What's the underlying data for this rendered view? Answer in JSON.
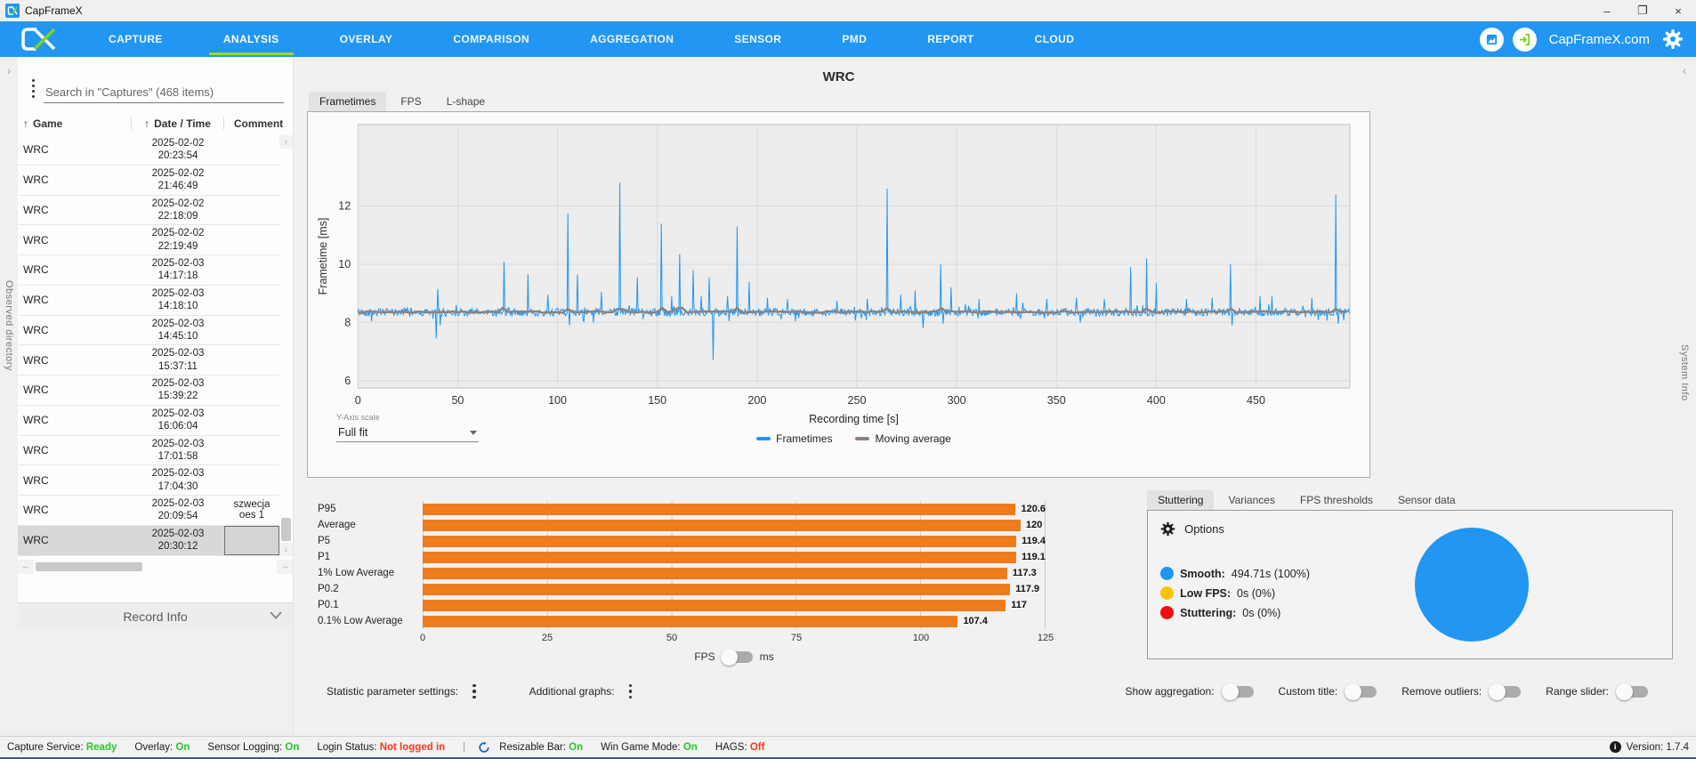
{
  "window": {
    "title": "CapFrameX",
    "controls": {
      "minimize": "–",
      "maximize": "❐",
      "close": "×"
    }
  },
  "nav": {
    "items": [
      {
        "label": "CAPTURE",
        "name": "nav-tab-capture",
        "active": false
      },
      {
        "label": "ANALYSIS",
        "name": "nav-tab-analysis",
        "active": true
      },
      {
        "label": "OVERLAY",
        "name": "nav-tab-overlay",
        "active": false
      },
      {
        "label": "COMPARISON",
        "name": "nav-tab-comparison",
        "active": false
      },
      {
        "label": "AGGREGATION",
        "name": "nav-tab-aggregation",
        "active": false
      },
      {
        "label": "SENSOR",
        "name": "nav-tab-sensor",
        "active": false
      },
      {
        "label": "PMD",
        "name": "nav-tab-pmd",
        "active": false
      },
      {
        "label": "REPORT",
        "name": "nav-tab-report",
        "active": false
      },
      {
        "label": "CLOUD",
        "name": "nav-tab-cloud",
        "active": false
      }
    ],
    "brand": "CapFrameX.com",
    "accent_green": "#A8D813",
    "bar_blue": "#2196F3"
  },
  "left_strip": {
    "label": "Observed directory"
  },
  "right_strip": {
    "label": "System Info"
  },
  "sidebar": {
    "search_placeholder": "Search in \"Captures\" (468 items)",
    "columns": [
      "Game",
      "Date / Time",
      "Comment"
    ],
    "rows": [
      {
        "game": "WRC",
        "date": "2025-02-02",
        "time": "20:23:54",
        "comment": "",
        "selected": false
      },
      {
        "game": "WRC",
        "date": "2025-02-02",
        "time": "21:46:49",
        "comment": "",
        "selected": false
      },
      {
        "game": "WRC",
        "date": "2025-02-02",
        "time": "22:18:09",
        "comment": "",
        "selected": false
      },
      {
        "game": "WRC",
        "date": "2025-02-02",
        "time": "22:19:49",
        "comment": "",
        "selected": false
      },
      {
        "game": "WRC",
        "date": "2025-02-03",
        "time": "14:17:18",
        "comment": "",
        "selected": false
      },
      {
        "game": "WRC",
        "date": "2025-02-03",
        "time": "14:18:10",
        "comment": "",
        "selected": false
      },
      {
        "game": "WRC",
        "date": "2025-02-03",
        "time": "14:45:10",
        "comment": "",
        "selected": false
      },
      {
        "game": "WRC",
        "date": "2025-02-03",
        "time": "15:37:11",
        "comment": "",
        "selected": false
      },
      {
        "game": "WRC",
        "date": "2025-02-03",
        "time": "15:39:22",
        "comment": "",
        "selected": false
      },
      {
        "game": "WRC",
        "date": "2025-02-03",
        "time": "16:06:04",
        "comment": "",
        "selected": false
      },
      {
        "game": "WRC",
        "date": "2025-02-03",
        "time": "17:01:58",
        "comment": "",
        "selected": false
      },
      {
        "game": "WRC",
        "date": "2025-02-03",
        "time": "17:04:30",
        "comment": "",
        "selected": false
      },
      {
        "game": "WRC",
        "date": "2025-02-03",
        "time": "20:09:54",
        "comment": "szwecja oes 1",
        "selected": false
      },
      {
        "game": "WRC",
        "date": "2025-02-03",
        "time": "20:30:12",
        "comment": "",
        "selected": true
      }
    ],
    "record_info": "Record Info"
  },
  "analysis": {
    "title": "WRC",
    "tabs": [
      {
        "label": "Frametimes",
        "active": true
      },
      {
        "label": "FPS",
        "active": false
      },
      {
        "label": "L-shape",
        "active": false
      }
    ],
    "yaxis_scale_label": "Y-Axis scale",
    "yaxis_scale_value": "Full fit"
  },
  "chart_data": [
    {
      "type": "line",
      "title": "WRC frametime graph",
      "ylabel": "Frametime [ms]",
      "xlabel": "Recording time [s]",
      "ylim": [
        5.75,
        14.8
      ],
      "x_range": [
        0,
        497
      ],
      "y_ticks": [
        6,
        8,
        10,
        12
      ],
      "x_ticks": [
        0,
        50,
        100,
        150,
        200,
        250,
        300,
        350,
        400,
        450
      ],
      "baseline_ms": 8.35,
      "noise_amplitude": 0.13,
      "series": [
        {
          "name": "Frametimes",
          "color": "#2196F3"
        },
        {
          "name": "Moving average",
          "color": "#8D817B"
        }
      ],
      "spikes_up": [
        [
          40,
          9.15
        ],
        [
          73,
          10.1
        ],
        [
          85,
          9.65
        ],
        [
          95,
          8.95
        ],
        [
          105,
          11.75
        ],
        [
          110,
          9.65
        ],
        [
          122,
          9.05
        ],
        [
          131,
          12.8
        ],
        [
          140,
          9.55
        ],
        [
          152,
          11.4
        ],
        [
          157,
          8.9
        ],
        [
          161,
          10.35
        ],
        [
          168,
          9.8
        ],
        [
          172,
          8.9
        ],
        [
          176,
          9.55
        ],
        [
          185,
          8.9
        ],
        [
          190,
          11.3
        ],
        [
          196,
          9.4
        ],
        [
          205,
          8.85
        ],
        [
          215,
          8.8
        ],
        [
          240,
          8.75
        ],
        [
          255,
          8.8
        ],
        [
          265,
          12.6
        ],
        [
          272,
          8.95
        ],
        [
          279,
          9.1
        ],
        [
          292,
          10.0
        ],
        [
          297,
          9.2
        ],
        [
          311,
          8.8
        ],
        [
          330,
          9.0
        ],
        [
          345,
          8.8
        ],
        [
          360,
          8.85
        ],
        [
          374,
          8.8
        ],
        [
          387,
          9.9
        ],
        [
          395,
          10.2
        ],
        [
          400,
          9.35
        ],
        [
          415,
          8.8
        ],
        [
          428,
          8.85
        ],
        [
          437,
          10.0
        ],
        [
          452,
          8.9
        ],
        [
          458,
          8.9
        ],
        [
          478,
          8.85
        ],
        [
          490,
          12.4
        ]
      ],
      "spikes_down": [
        [
          39,
          7.45
        ],
        [
          41,
          7.9
        ],
        [
          106,
          7.9
        ],
        [
          118,
          8.0
        ],
        [
          178,
          6.7
        ],
        [
          186,
          8.05
        ],
        [
          283,
          7.8
        ],
        [
          293,
          7.95
        ],
        [
          362,
          8.0
        ],
        [
          438,
          7.9
        ],
        [
          491,
          7.95
        ]
      ],
      "grid": true,
      "legend_position": "bottom"
    },
    {
      "type": "bar",
      "categories": [
        "P95",
        "Average",
        "P5",
        "P1",
        "1% Low Average",
        "P0.2",
        "P0.1",
        "0.1% Low Average"
      ],
      "values": [
        120.6,
        120,
        119.4,
        119.1,
        117.3,
        117.9,
        117,
        107.4
      ],
      "value_labels": [
        "120.6",
        "120",
        "119.4",
        "119.1",
        "117.3",
        "117.9",
        "117",
        "107.4"
      ],
      "x_ticks": [
        0,
        25,
        50,
        75,
        100,
        125
      ],
      "xlim": [
        0,
        125
      ],
      "bar_color": "#EE7C1C",
      "unit_left": "FPS",
      "unit_right": "ms",
      "title": "FPS percentile statistics"
    },
    {
      "type": "pie",
      "title": "Stuttering time shares",
      "slices": [
        {
          "label": "Smooth",
          "value": 100,
          "color": "#2196F3"
        },
        {
          "label": "Low FPS",
          "value": 0,
          "color": "#FFC20A"
        },
        {
          "label": "Stuttering",
          "value": 0,
          "color": "#F50D0D"
        }
      ]
    }
  ],
  "stutter": {
    "tabs": [
      {
        "label": "Stuttering",
        "active": true
      },
      {
        "label": "Variances",
        "active": false
      },
      {
        "label": "FPS thresholds",
        "active": false
      },
      {
        "label": "Sensor data",
        "active": false
      }
    ],
    "options_label": "Options",
    "legend": [
      {
        "label": "Smooth:",
        "value": "494.71s (100%)",
        "color": "#2196F3"
      },
      {
        "label": "Low FPS:",
        "value": "0s (0%)",
        "color": "#FFC20A"
      },
      {
        "label": "Stuttering:",
        "value": "0s (0%)",
        "color": "#F50D0D"
      }
    ]
  },
  "settings_row": {
    "stat_label": "Statistic parameter settings:",
    "graphs_label": "Additional graphs:",
    "toggles": [
      {
        "label": "Show aggregation:",
        "on": false
      },
      {
        "label": "Custom title:",
        "on": false
      },
      {
        "label": "Remove outliers:",
        "on": false
      },
      {
        "label": "Range slider:",
        "on": false
      }
    ]
  },
  "statusbar": {
    "group1": [
      {
        "label": "Capture Service:",
        "value": "Ready",
        "color": "#2EC32E"
      },
      {
        "label": "Overlay:",
        "value": "On",
        "color": "#2EC32E"
      },
      {
        "label": "Sensor Logging:",
        "value": "On",
        "color": "#2EC32E"
      },
      {
        "label": "Login Status:",
        "value": "Not logged in",
        "color": "#F9391F"
      }
    ],
    "group2": [
      {
        "label": "Resizable Bar:",
        "value": "On",
        "color": "#2EC32E"
      },
      {
        "label": "Win Game Mode:",
        "value": "On",
        "color": "#2EC32E"
      },
      {
        "label": "HAGS:",
        "value": "Off",
        "color": "#F9391F"
      }
    ],
    "version_label": "Version: 1.7.4"
  }
}
